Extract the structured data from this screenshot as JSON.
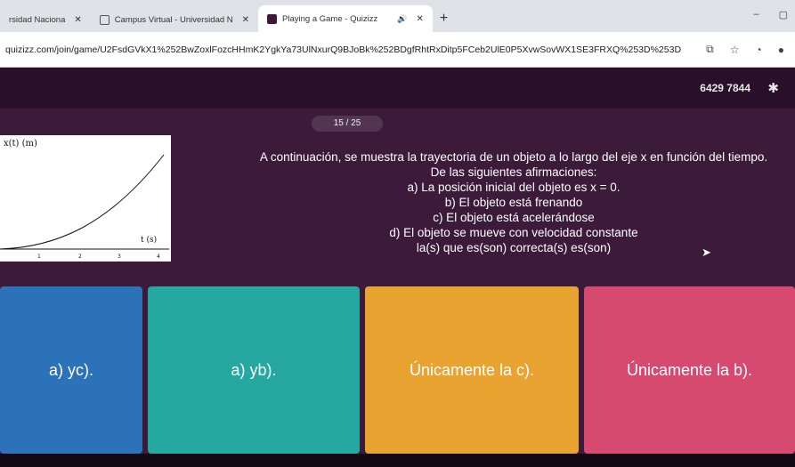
{
  "browser": {
    "tabs": [
      {
        "title": "rsidad Naciona",
        "favicon_color": "#1a5ea8",
        "active": false
      },
      {
        "title": "Campus Virtual - Universidad N",
        "favicon_color": "#555555",
        "active": false
      },
      {
        "title": "Playing a Game - Quizizz",
        "favicon_color": "#3b1a3a",
        "active": true
      }
    ],
    "new_tab": "+",
    "url": "quizizz.com/join/game/U2FsdGVkX1%252BwZoxlFozcHHmK2YgkYa73UlNxurQ9BJoBk%252BDgfRhtRxDitp5FCeb2UlE0P5XvwSovWX1SE3FRXQ%253D%253D"
  },
  "game": {
    "score": "6429  7844",
    "counter": "15 / 25"
  },
  "figure": {
    "ylabel": "x(t) (m)",
    "xlabel": "t (s)",
    "ticks": [
      "1",
      "2",
      "3",
      "4"
    ]
  },
  "question": {
    "lines": [
      "A continuación, se muestra la trayectoria de un objeto a lo largo del eje x en función del tiempo.",
      "De las siguientes afirmaciones:",
      "a) La posición inicial del objeto es x = 0.",
      "b) El objeto está frenando",
      "c) El objeto está acelerándose",
      "d) El objeto se mueve con velocidad constante",
      "la(s) que es(son) correcta(s) es(son)"
    ]
  },
  "answers": [
    {
      "label": "a) yc).",
      "color": "#2c72b8"
    },
    {
      "label": "a) yb).",
      "color": "#26a8a0"
    },
    {
      "label": "Únicamente la c).",
      "color": "#e8a331"
    },
    {
      "label": "Únicamente la b).",
      "color": "#d64a70"
    }
  ]
}
